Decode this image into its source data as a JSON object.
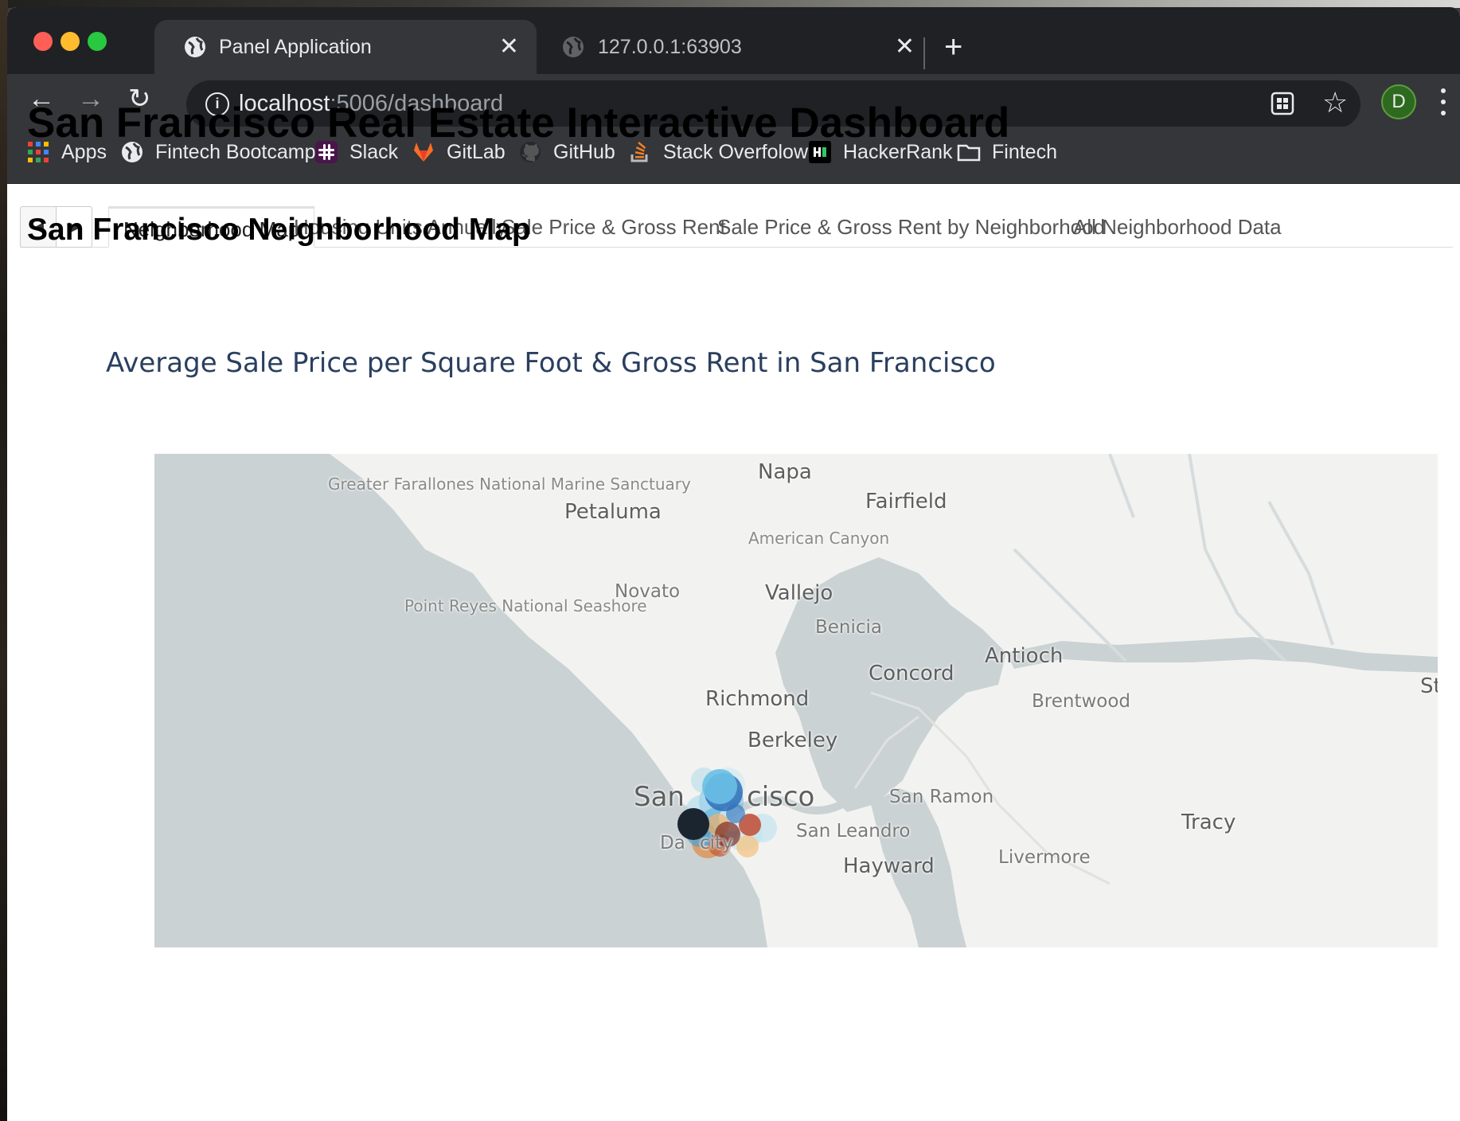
{
  "browser": {
    "tabs": [
      {
        "title": "Panel Application",
        "active": true
      },
      {
        "title": "127.0.0.1:63903",
        "active": false
      }
    ],
    "url_host": "localhost",
    "url_path": ":5006/dashboard",
    "profile_initial": "D",
    "bookmarks": [
      "Apps",
      "Fintech Bootcamp",
      "Slack",
      "GitLab",
      "GitHub",
      "Stack Overfolow",
      "HackerRank",
      "Fintech"
    ]
  },
  "panel": {
    "tabs": [
      "Neighborhood Map",
      "Housing Units Annually",
      "Sale Price & Gross Rent",
      "Sale Price & Gross Rent by Neighborhood",
      "All Neighborhood Data"
    ],
    "active_tab": "Neighborhood Map"
  },
  "page": {
    "title": "San Francisco Real Estate Interactive Dashboard",
    "section_title": "San Francisco Neighborhood Map",
    "chart_title": "Average Sale Price per Square Foot & Gross Rent in San Francisco"
  },
  "map": {
    "place_labels": [
      "Napa",
      "Petaluma",
      "Fairfield",
      "Greater Farallones National Marine Sanctuary",
      "American Canyon",
      "Novato",
      "Vallejo",
      "Point Reyes National Seashore",
      "Benicia",
      "Antioch",
      "Concord",
      "Richmond",
      "Brentwood",
      "St",
      "Berkeley",
      "San",
      "cisco",
      "San Ramon",
      "San Leandro",
      "Tracy",
      "Da",
      "city",
      "Livermore",
      "Hayward"
    ],
    "colors": {
      "water": "#cad2d3",
      "land": "#f2f2f1",
      "title": "#2a3f5f"
    }
  }
}
